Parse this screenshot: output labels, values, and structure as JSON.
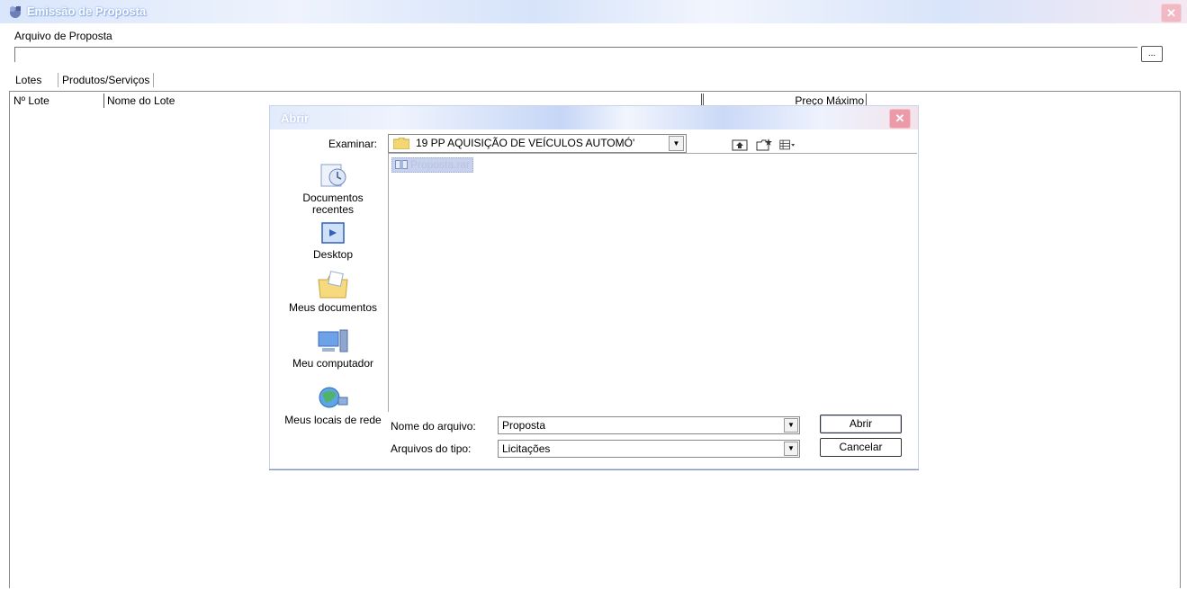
{
  "main_window": {
    "title": "Emissão de Proposta",
    "file_label": "Arquivo de Proposta",
    "file_value": "",
    "browse_label": "...",
    "tabs": [
      {
        "label": "Lotes"
      },
      {
        "label": "Produtos/Serviços"
      }
    ],
    "grid": {
      "columns": [
        "Nº Lote",
        "Nome do Lote",
        "Preço Máximo"
      ]
    }
  },
  "dialog": {
    "title": "Abrir",
    "lookin_label": "Examinar:",
    "lookin_value": "19 PP AQUISIÇÃO DE VEÍCULOS AUTOMÓ'",
    "places": [
      {
        "label": "Documentos recentes",
        "icon": "recent-documents-icon"
      },
      {
        "label": "Desktop",
        "icon": "desktop-icon"
      },
      {
        "label": "Meus documentos",
        "icon": "my-documents-icon"
      },
      {
        "label": "Meu computador",
        "icon": "my-computer-icon"
      },
      {
        "label": "Meus locais de rede",
        "icon": "network-places-icon"
      }
    ],
    "files": [
      {
        "name": "Proposta.rar"
      }
    ],
    "filename_label": "Nome do arquivo:",
    "filename_value": "Proposta",
    "filetype_label": "Arquivos do tipo:",
    "filetype_value": "Licitações",
    "open_label": "Abrir",
    "cancel_label": "Cancelar"
  }
}
